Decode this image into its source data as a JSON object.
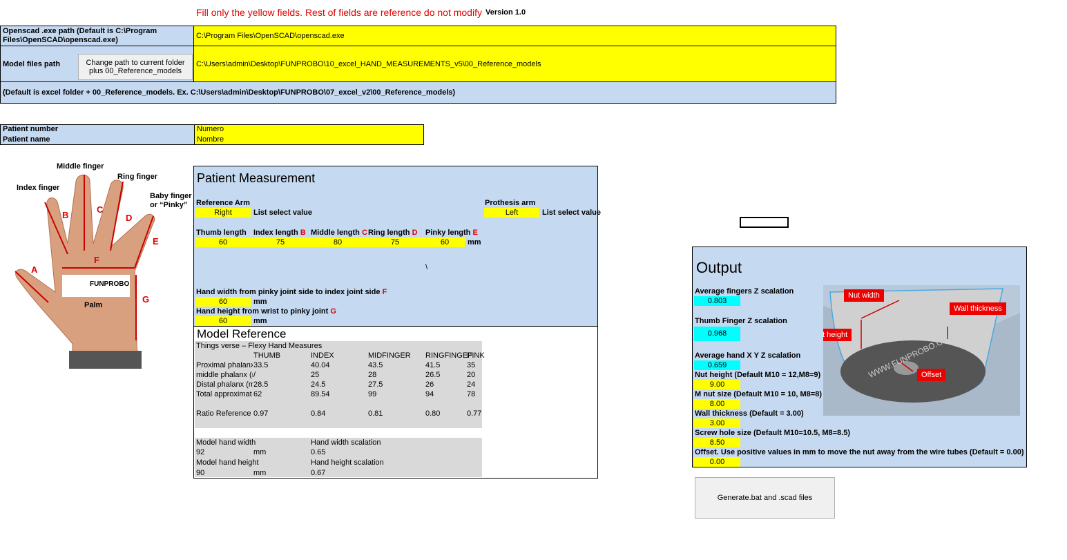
{
  "header": {
    "instruction": "Fill only the yellow fields. Rest of fields are reference do not modify",
    "version": "Version 1.0"
  },
  "config": {
    "openscad_label": "Openscad .exe path (Default is C:\\Program Files\\OpenSCAD\\openscad.exe)",
    "openscad_value": "C:\\Program Files\\OpenSCAD\\openscad.exe",
    "model_label": "Model files path",
    "change_path_button": "Change path to current folder plus 00_Reference_models",
    "model_value": "C:\\Users\\admin\\Desktop\\FUNPROBO\\10_excel_HAND_MEASUREMENTS_v5\\00_Reference_models",
    "default_note": "(Default is excel folder + 00_Reference_models. Ex. C:\\Users\\admin\\Desktop\\FUNPROBO\\07_excel_v2\\00_Reference_models)"
  },
  "patient": {
    "number_label": "Patient number",
    "number_value": "Numero",
    "name_label": "Patient name",
    "name_value": "Nombre"
  },
  "hand_image": {
    "middle": "Middle finger",
    "index": "Index finger",
    "ring": "Ring finger",
    "baby": "Baby finger or “Pinky”",
    "palm": "Palm",
    "logo": "FUNPROBO",
    "letters": [
      "A",
      "B",
      "C",
      "D",
      "E",
      "F",
      "G"
    ]
  },
  "measurement": {
    "title": "Patient Measurement",
    "ref_arm_label": "Reference Arm",
    "ref_arm_value": "Right",
    "list_select": "List select value",
    "prosthesis_label": "Prothesis arm",
    "prosthesis_value": "Left",
    "fingers": [
      {
        "label": "Thumb length",
        "letter": "",
        "value": "60"
      },
      {
        "label": "Index length",
        "letter": "B",
        "value": "75"
      },
      {
        "label": "Middle length",
        "letter": "C",
        "value": "80"
      },
      {
        "label": "Ring length",
        "letter": "D",
        "value": "75"
      },
      {
        "label": "Pinky length",
        "letter": "E",
        "value": "60"
      }
    ],
    "mm": "mm",
    "stray": "\\",
    "width_label": "Hand width from pinky joint side to index joint side",
    "width_letter": "F",
    "width_value": "60",
    "height_label": "Hand height from wrist to pinky joint",
    "height_letter": "G",
    "height_value": "60"
  },
  "model_reference": {
    "title": "Model Reference",
    "subtitle": "Things verse – Flexy Hand Measures",
    "columns": [
      "THUMB",
      "INDEX",
      "MIDFINGER",
      "RINGFINGEF",
      "PINK"
    ],
    "rows": [
      {
        "label": "Proximal phalanx",
        "values": [
          "33.5",
          "40.04",
          "43.5",
          "41.5",
          "35"
        ]
      },
      {
        "label": "middle phalanx (r",
        "values": [
          "/",
          "25",
          "28",
          "26.5",
          "20"
        ]
      },
      {
        "label": "Distal phalanx (m",
        "values": [
          "28.5",
          "24.5",
          "27.5",
          "26",
          "24"
        ]
      },
      {
        "label": "Total approximat",
        "values": [
          "62",
          "89.54",
          "99",
          "94",
          "78"
        ]
      }
    ],
    "ratio": {
      "label": "Ratio Reference",
      "values": [
        "0.97",
        "0.84",
        "0.81",
        "0.80",
        "0.77"
      ]
    },
    "hand_width_label": "Model hand width",
    "hand_width_value": "92",
    "hand_width_scal_label": "Hand width scalation",
    "hand_width_scal": "0.65",
    "hand_height_label": "Model hand height",
    "hand_height_value": "90",
    "hand_height_scal_label": "Hand height scalation",
    "hand_height_scal": "0.67",
    "mm": "mm"
  },
  "output": {
    "title": "Output",
    "avg_fingers_label": "Average fingers Z scalation",
    "avg_fingers": "0.803",
    "thumb_label": "Thumb Finger Z scalation",
    "thumb": "0.968",
    "avg_hand_label": "Average hand X Y Z scalation",
    "avg_hand": "0.659",
    "nut_height_label": "Nut height (Default M10 = 12,M8=9)",
    "nut_height": "9.00",
    "nut_size_label": "M nut size (Default M10 = 10, M8=8)",
    "nut_size": "8.00",
    "wall_label": "Wall thickness (Default = 3.00)",
    "wall": "3.00",
    "screw_label": "Screw hole size (Default M10=10.5, M8=8.5)",
    "screw": "8.50",
    "offset_label": "Offset. Use positive values in mm to move the nut away from the wire tubes (Default = 0.00)",
    "offset": "0.00",
    "diagram": {
      "nut_width": "Nut width",
      "wall_thickness": "Wall thickness",
      "nut_height": "Nut height",
      "offset": "Offset",
      "engraving": "WWW.FUNPROBO.ORG"
    }
  },
  "generate_button": "Generate.bat  and .scad files"
}
